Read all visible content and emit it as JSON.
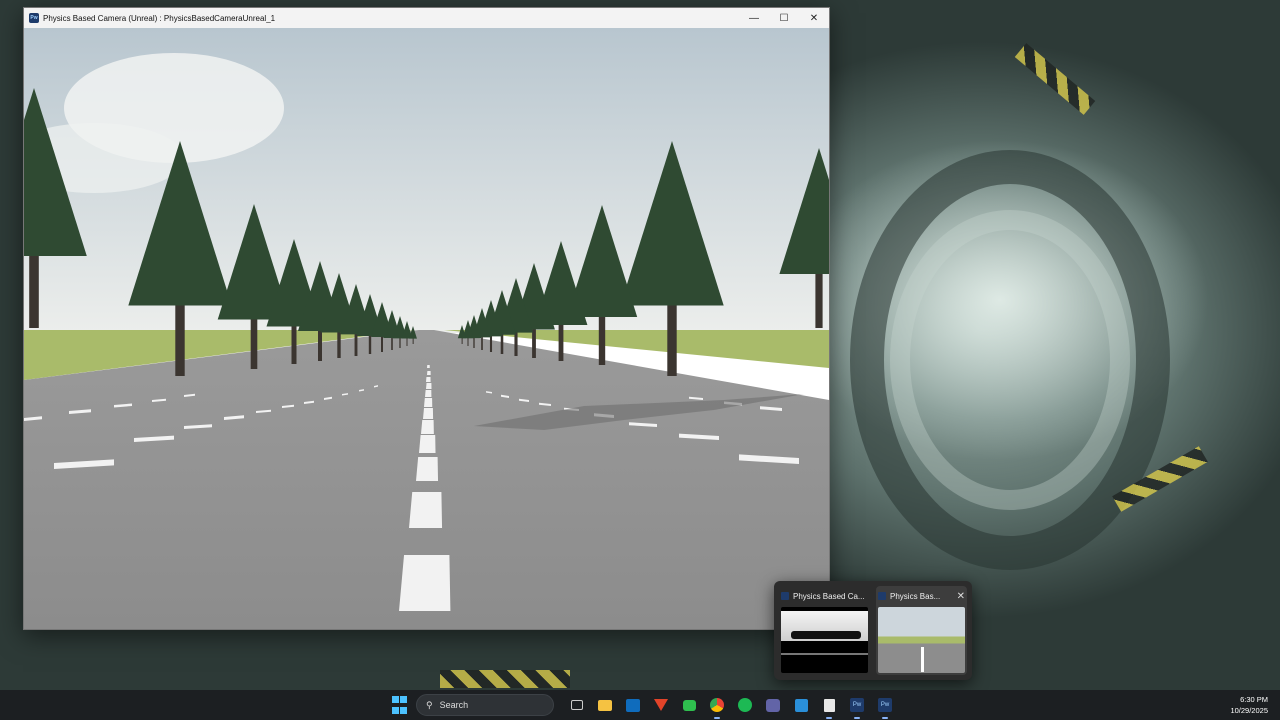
{
  "window": {
    "title": "Physics Based Camera (Unreal) : PhysicsBasedCameraUnreal_1",
    "icon": "unreal-app-icon",
    "controls": {
      "minimize": "—",
      "maximize": "☐",
      "close": "✕"
    }
  },
  "thumbnails": [
    {
      "label": "Physics Based Ca...",
      "active": false
    },
    {
      "label": "Physics Bas...",
      "active": true,
      "close": "✕"
    }
  ],
  "taskbar": {
    "search_placeholder": "Search",
    "icons": [
      "windows-start-icon",
      "search-icon",
      "task-view-icon",
      "file-explorer-icon",
      "outlook-icon",
      "gitlab-icon",
      "app-green-icon",
      "chrome-icon",
      "spotify-icon",
      "teams-icon",
      "vscode-icon",
      "notepad-icon",
      "pw-app-icon-1",
      "pw-app-icon-2"
    ],
    "app_label_pw": "Pw",
    "clock_time": "6:30 PM",
    "clock_date": "10/29/2025"
  },
  "colors": {
    "accent": "#4cc2ff",
    "taskbar_bg": "#1c1f22",
    "road": "#8a8a8a",
    "grass": "#a9bb6a",
    "sky_top": "#c4d0d8",
    "tree": "#2f4a32"
  }
}
